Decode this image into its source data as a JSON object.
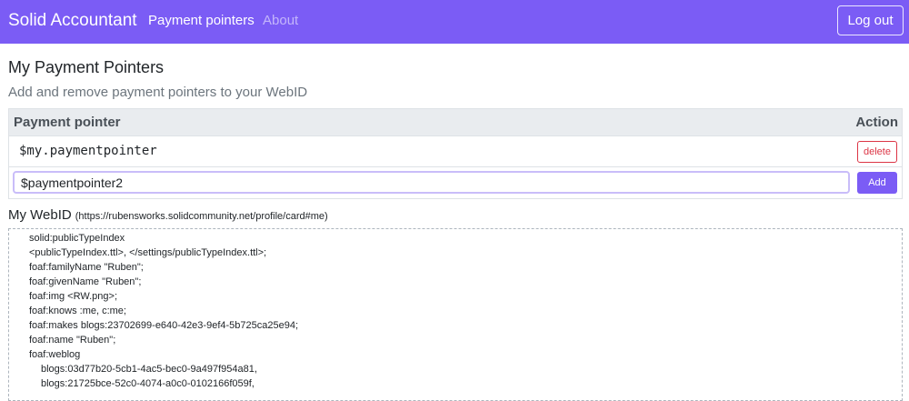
{
  "nav": {
    "brand": "Solid Accountant",
    "links": [
      "Payment pointers",
      "About"
    ],
    "logout_label": "Log out"
  },
  "page": {
    "title": "My Payment Pointers",
    "subtitle": "Add and remove payment pointers to your WebID"
  },
  "table": {
    "headers": [
      "Payment pointer",
      "Action"
    ],
    "rows": [
      {
        "pointer": "$my.paymentpointer",
        "action_label": "delete"
      }
    ],
    "new_row": {
      "input_value": "$paymentpointer2",
      "add_label": "Add"
    }
  },
  "webid": {
    "heading": "My WebID",
    "url": "(https://rubensworks.solidcommunity.net/profile/card#me)",
    "turtle_lines": [
      "solid:publicTypeIndex",
      "<publicTypeIndex.ttl>, </settings/publicTypeIndex.ttl>;",
      "foaf:familyName \"Ruben\";",
      "foaf:givenName \"Ruben\";",
      "foaf:img <RW.png>;",
      "foaf:knows :me, c:me;",
      "foaf:makes blogs:23702699-e640-42e3-9ef4-5b725ca25e94;",
      "foaf:name \"Ruben\";",
      "foaf:weblog",
      "blogs:03d77b20-5cb1-4ac5-bec0-9a497f954a81,",
      "blogs:21725bce-52c0-4074-a0c0-0102166f059f,"
    ]
  },
  "colors": {
    "primary": "#7b5cf5",
    "danger": "#dc3545"
  }
}
